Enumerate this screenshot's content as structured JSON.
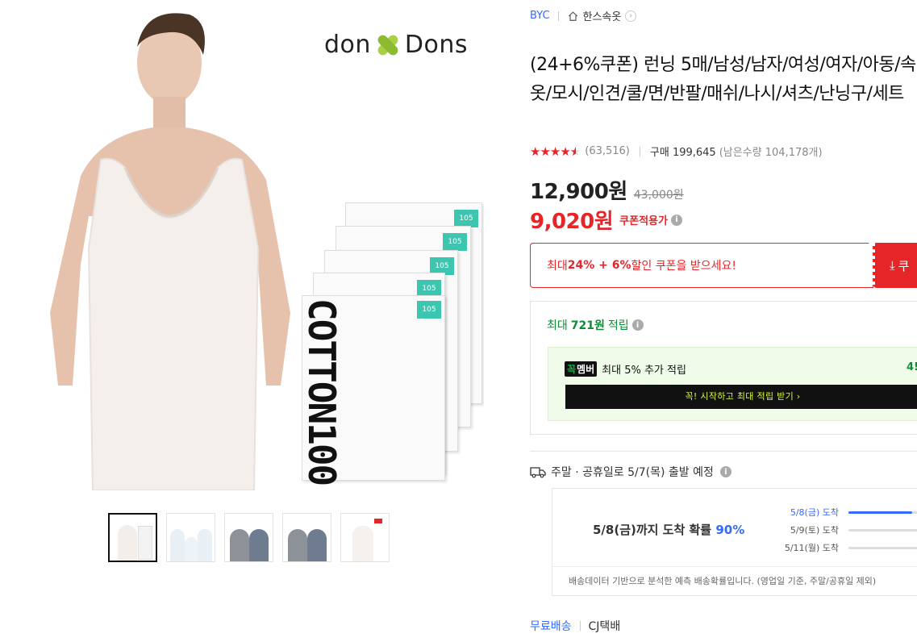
{
  "breadcrumb": {
    "brand": "BYC",
    "category": "한스속옷"
  },
  "product": {
    "title": "(24+6%쿠폰) 런닝 5매/남성/남자/여성/여자/아동/속옷/모시/인견/쿨/면/반팔/매쉬/나시/셔츠/난닝구/세트",
    "logo_text_left": "don",
    "logo_text_right": "Dons",
    "image_text": "COTTON100",
    "rating_value": 4.5,
    "rating_count": "(63,516)",
    "purchase": "구매 199,645",
    "remaining": "(남은수량 104,178개)",
    "price": "12,900원",
    "original_price": "43,000원",
    "coupon_price": "9,020원",
    "coupon_label": "쿠폰적용가"
  },
  "coupon_box": {
    "prefix": "최대 ",
    "highlight": "24% + 6%",
    "suffix": " 할인 쿠폰을 받으세요!",
    "button": "쿠"
  },
  "reward": {
    "prefix": "최대",
    "amount": "721원",
    "suffix": "적립",
    "member_logo_a": "꼭",
    "member_logo_b": "멤버",
    "member_text": "최대 5% 추가 적립",
    "member_pct": "4!",
    "member_button": "꼭! 시작하고 최대 적립 받기 ›"
  },
  "shipping": {
    "notice": "주말 · 공휴일로 5/7(목) 출발 예정",
    "arrive_prefix": "5/8(금)까지 도착 확률",
    "arrive_pct": "90%",
    "bars": [
      {
        "label": "5/8(금) 도착",
        "fill": 0.9
      },
      {
        "label": "5/9(토) 도착",
        "fill": 0.0
      },
      {
        "label": "5/11(월) 도착",
        "fill": 0.0
      }
    ],
    "note": "배송데이터 기반으로 분석한 예측 배송확률입니다. (영업일 기준, 주말/공휴일 제외)"
  },
  "delivery": {
    "free": "무료배송",
    "carrier": "CJ택배"
  },
  "colors": {
    "red": "#e52528",
    "blue": "#346aff",
    "green": "#0a8d35"
  },
  "thumbnails": [
    {
      "name": "thumb-white-tank-cotton"
    },
    {
      "name": "thumb-family-set"
    },
    {
      "name": "thumb-gray-tshirt"
    },
    {
      "name": "thumb-gray-tshirt-2"
    },
    {
      "name": "thumb-byc-model"
    }
  ]
}
